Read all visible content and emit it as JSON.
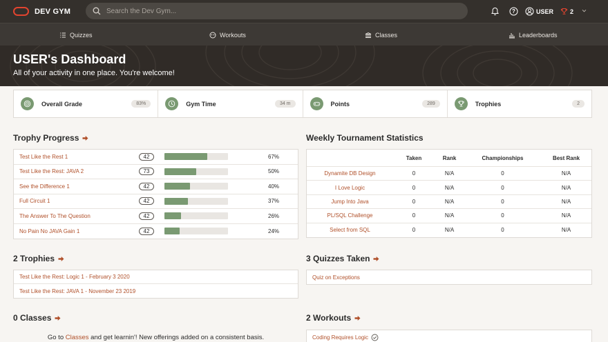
{
  "topbar": {
    "brand": "DEV GYM",
    "search_placeholder": "Search the Dev Gym...",
    "user_label": "USER",
    "trophy_count": "2"
  },
  "nav": [
    {
      "label": "Quizzes",
      "icon": "list-icon"
    },
    {
      "label": "Workouts",
      "icon": "workouts-icon"
    },
    {
      "label": "Classes",
      "icon": "classes-icon"
    },
    {
      "label": "Leaderboards",
      "icon": "leaderboard-icon"
    }
  ],
  "hero": {
    "title": "USER's Dashboard",
    "subtitle": "All of your activity in one place. You're welcome!"
  },
  "stats": [
    {
      "label": "Overall Grade",
      "value": "83%",
      "icon": "target-icon"
    },
    {
      "label": "Gym Time",
      "value": "34 m",
      "icon": "clock-icon"
    },
    {
      "label": "Points",
      "value": "289",
      "icon": "gamepad-icon"
    },
    {
      "label": "Trophies",
      "value": "2",
      "icon": "trophy-icon"
    }
  ],
  "trophy_progress": {
    "title": "Trophy Progress",
    "rows": [
      {
        "name": "Test Like the Rest 1",
        "count": "42",
        "pct": "67%",
        "fill": 0.67
      },
      {
        "name": "Test Like the Rest: JAVA 2",
        "count": "73",
        "pct": "50%",
        "fill": 0.5
      },
      {
        "name": "See the Difference 1",
        "count": "42",
        "pct": "40%",
        "fill": 0.4
      },
      {
        "name": "Full Circuit 1",
        "count": "42",
        "pct": "37%",
        "fill": 0.37
      },
      {
        "name": "The Answer To The Question",
        "count": "42",
        "pct": "26%",
        "fill": 0.26
      },
      {
        "name": "No Pain No JAVA Gain 1",
        "count": "42",
        "pct": "24%",
        "fill": 0.24
      }
    ]
  },
  "weekly": {
    "title": "Weekly Tournament Statistics",
    "headers": [
      "",
      "Taken",
      "Rank",
      "Championships",
      "Best Rank"
    ],
    "rows": [
      {
        "name": "Dynamite DB Design",
        "taken": "0",
        "rank": "N/A",
        "champ": "0",
        "best": "N/A"
      },
      {
        "name": "I Love Logic",
        "taken": "0",
        "rank": "N/A",
        "champ": "0",
        "best": "N/A"
      },
      {
        "name": "Jump Into Java",
        "taken": "0",
        "rank": "N/A",
        "champ": "0",
        "best": "N/A"
      },
      {
        "name": "PL/SQL Challenge",
        "taken": "0",
        "rank": "N/A",
        "champ": "0",
        "best": "N/A"
      },
      {
        "name": "Select from SQL",
        "taken": "0",
        "rank": "N/A",
        "champ": "0",
        "best": "N/A"
      }
    ]
  },
  "trophies": {
    "title": "2 Trophies",
    "items": [
      "Test Like the Rest: Logic 1 - February 3 2020",
      "Test Like the Rest: JAVA 1 - November 23 2019"
    ]
  },
  "quizzes": {
    "title": "3 Quizzes Taken",
    "items": [
      "Quiz on Exceptions"
    ]
  },
  "classes": {
    "title": "0 Classes",
    "text_before": "Go to ",
    "link": "Classes",
    "text_after": " and get learnin'! New offerings added on a consistent basis."
  },
  "workouts": {
    "title": "2 Workouts",
    "items": [
      "Coding Requires Logic"
    ]
  },
  "colors": {
    "accent": "#b0502a",
    "green": "#7a9a72",
    "topbar": "#34302c",
    "brand_red": "#e2442f"
  }
}
